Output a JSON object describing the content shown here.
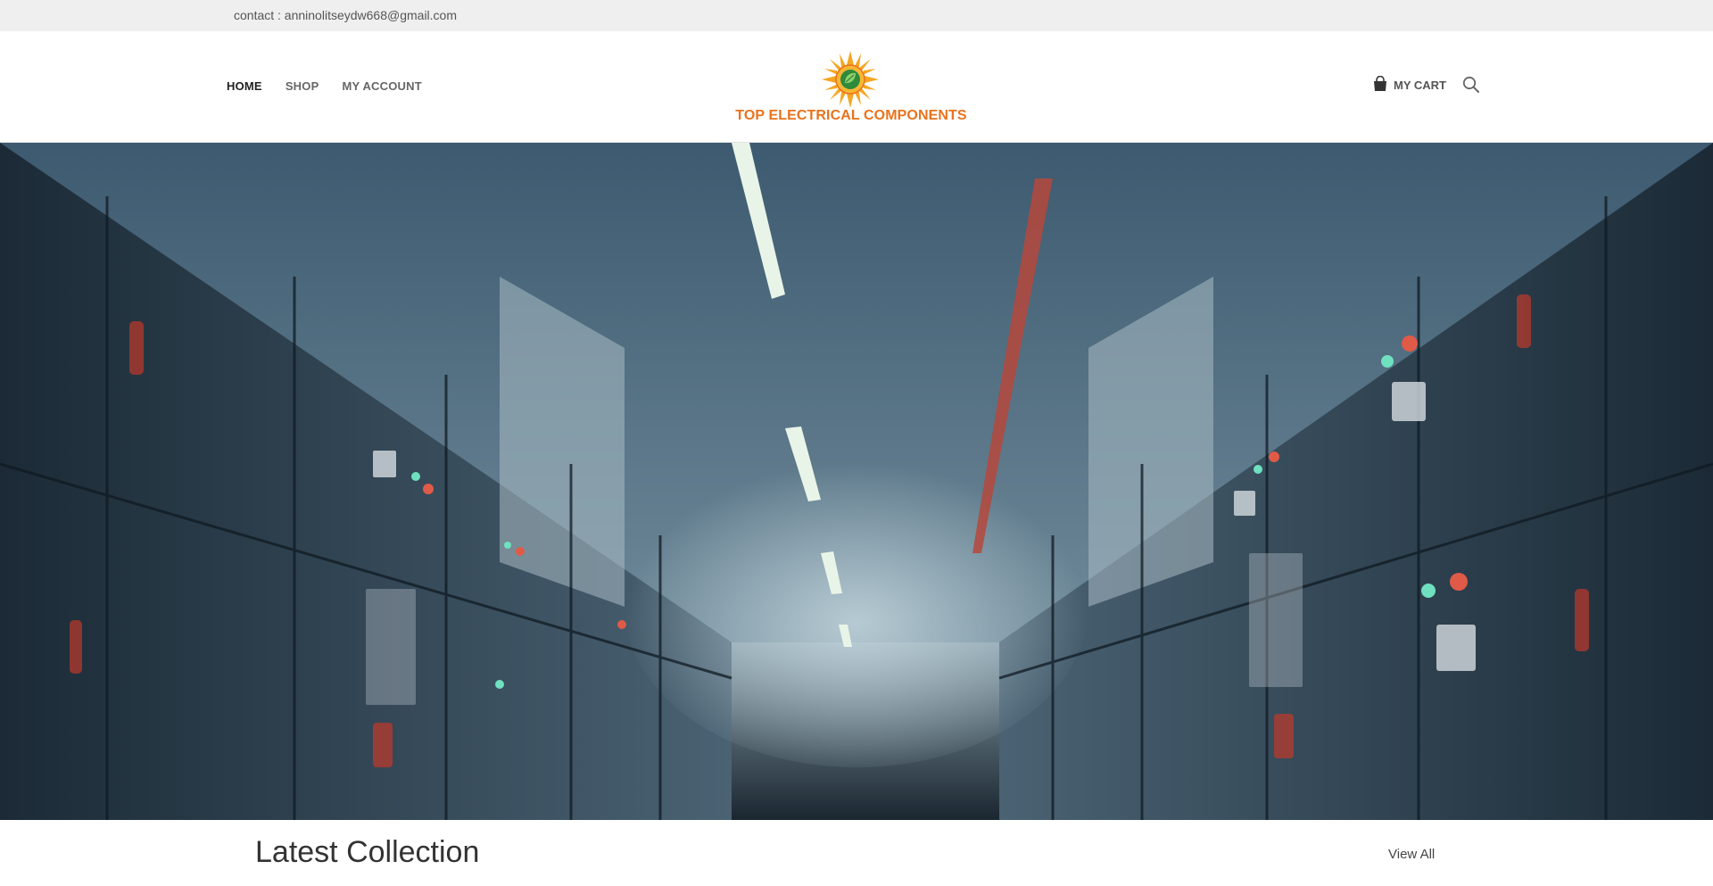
{
  "topbar": {
    "contact": "contact : anninolitseydw668@gmail.com"
  },
  "nav": {
    "items": [
      {
        "label": "HOME",
        "active": true
      },
      {
        "label": "SHOP",
        "active": false
      },
      {
        "label": "MY ACCOUNT",
        "active": false
      }
    ]
  },
  "brand": {
    "name": "TOP ELECTRICAL COMPONENTS",
    "accent": "#e8731d",
    "sun": "#f5a623",
    "leaf": "#2f8a3c"
  },
  "header_actions": {
    "cart_label": "MY CART",
    "cart_icon": "shopping-bag-icon",
    "search_icon": "search-icon"
  },
  "hero": {
    "subject": "electrical switchgear room corridor",
    "tone": "#2c4556"
  },
  "collection": {
    "title": "Latest Collection",
    "view_all": "View All"
  }
}
